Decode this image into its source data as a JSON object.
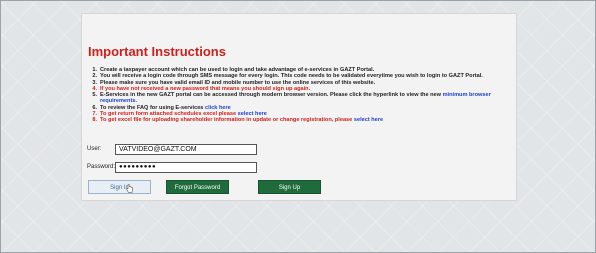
{
  "title": "Important Instructions",
  "instructions": [
    {
      "num": "1.",
      "color": "dark",
      "parts": [
        {
          "text": "Create a taxpayer account which can be used to login and take advantage of e-services in GAZT Portal.",
          "link": false
        }
      ]
    },
    {
      "num": "2.",
      "color": "dark",
      "parts": [
        {
          "text": "You will receive a login code through SMS message for every login. This code needs to be validated everytime you wish to login to GAZT Portal.",
          "link": false
        }
      ]
    },
    {
      "num": "3.",
      "color": "dark",
      "parts": [
        {
          "text": "Please make sure you have valid email ID and mobile number to use the online services of this website.",
          "link": false
        }
      ]
    },
    {
      "num": "4.",
      "color": "red",
      "parts": [
        {
          "text": "If you have not received a new password that means you should sign up again.",
          "link": false
        }
      ]
    },
    {
      "num": "5.",
      "color": "dark",
      "parts": [
        {
          "text": "E-Services in the new GAZT portal can be accessed through modern browser version. Please click the hyperlink to view the new ",
          "link": false
        },
        {
          "text": "minimum browser requirements.",
          "link": true
        }
      ]
    },
    {
      "num": "6.",
      "color": "dark",
      "parts": [
        {
          "text": "To review the FAQ for using E-services ",
          "link": false
        },
        {
          "text": "click here",
          "link": true
        }
      ]
    },
    {
      "num": "7.",
      "color": "red",
      "parts": [
        {
          "text": "To get return form attached schedules excel please ",
          "link": false
        },
        {
          "text": "select here",
          "link": true
        }
      ]
    },
    {
      "num": "8.",
      "color": "red",
      "parts": [
        {
          "text": "To get excel file for uploading shareholder information in update or change registration, please ",
          "link": false
        },
        {
          "text": "select here",
          "link": true
        }
      ]
    }
  ],
  "form": {
    "user_label": "User:",
    "user_value": "VATVIDEO@GAZT.COM",
    "password_label": "Password:",
    "password_value": "●●●●●●●●●"
  },
  "buttons": {
    "signin": "Sign In",
    "forgot": "Forgot Password",
    "signup": "Sign Up"
  }
}
